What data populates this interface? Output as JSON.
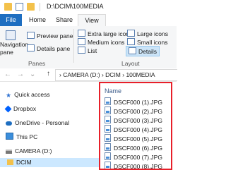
{
  "window": {
    "title": "D:\\DCIM\\100MEDIA"
  },
  "ribbon": {
    "tabs": [
      "File",
      "Home",
      "Share",
      "View"
    ],
    "panes_group": {
      "label": "Panes",
      "nav_pane": "Navigation\npane",
      "preview_pane": "Preview pane",
      "details_pane": "Details pane"
    },
    "layout_group": {
      "label": "Layout",
      "extra_large_icons": "Extra large icons",
      "large_icons": "Large icons",
      "medium_icons": "Medium icons",
      "small_icons": "Small icons",
      "list": "List",
      "details": "Details"
    }
  },
  "address": {
    "back": "←",
    "forward": "→",
    "recent": "⌄",
    "up": "↑",
    "path": "›  CAMERA (D:)  ›  DCIM  ›  100MEDIA"
  },
  "nav_pane": {
    "items": [
      {
        "label": "Quick access",
        "icon": "star-icon"
      },
      {
        "label": "Dropbox",
        "icon": "dropbox-icon"
      },
      {
        "label": "OneDrive - Personal",
        "icon": "cloud-icon"
      },
      {
        "label": "This PC",
        "icon": "computer-icon"
      },
      {
        "label": "CAMERA (D:)",
        "icon": "drive-icon"
      },
      {
        "label": "DCIM",
        "icon": "folder-icon"
      }
    ]
  },
  "file_list": {
    "column_header": "Name",
    "files": [
      "DSCF000 (1).JPG",
      "DSCF000 (2).JPG",
      "DSCF000 (3).JPG",
      "DSCF000 (4).JPG",
      "DSCF000 (5).JPG",
      "DSCF000 (6).JPG",
      "DSCF000 (7).JPG",
      "DSCF000 (8).JPG"
    ]
  },
  "colors": {
    "accent": "#1e6ec0",
    "highlight_border": "#e8202a",
    "selection": "#cce8ff"
  }
}
